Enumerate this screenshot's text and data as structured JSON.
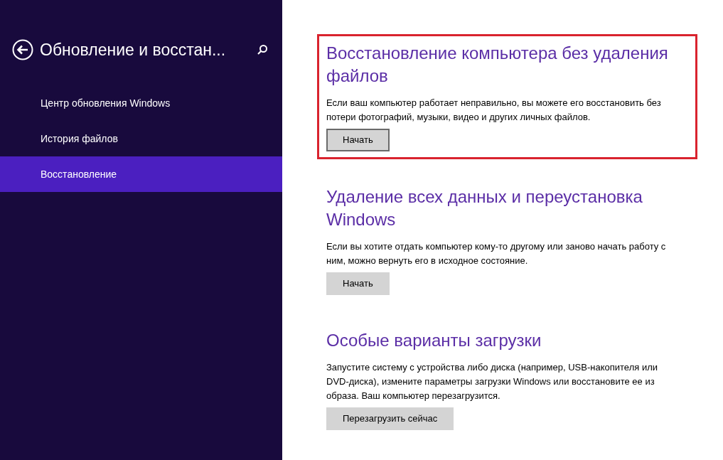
{
  "sidebar": {
    "title": "Обновление и восстан...",
    "items": [
      {
        "label": "Центр обновления Windows",
        "selected": false
      },
      {
        "label": "История файлов",
        "selected": false
      },
      {
        "label": "Восстановление",
        "selected": true
      }
    ]
  },
  "sections": [
    {
      "heading": "Восстановление компьютера без удаления файлов",
      "text": "Если ваш компьютер работает неправильно, вы можете его восстановить без потери фотографий, музыки, видео и других личных файлов.",
      "button": "Начать",
      "focused": true,
      "highlighted": true
    },
    {
      "heading": "Удаление всех данных и переустановка Windows",
      "text": "Если вы хотите отдать компьютер кому-то другому или заново начать работу с ним, можно вернуть его в исходное состояние.",
      "button": "Начать",
      "focused": false,
      "highlighted": false
    },
    {
      "heading": "Особые варианты загрузки",
      "text": "Запустите систему с устройства либо диска (например, USB-накопителя или DVD-диска), измените параметры загрузки Windows или восстановите ее из образа. Ваш компьютер перезагрузится.",
      "button": "Перезагрузить сейчас",
      "focused": false,
      "highlighted": false
    }
  ]
}
